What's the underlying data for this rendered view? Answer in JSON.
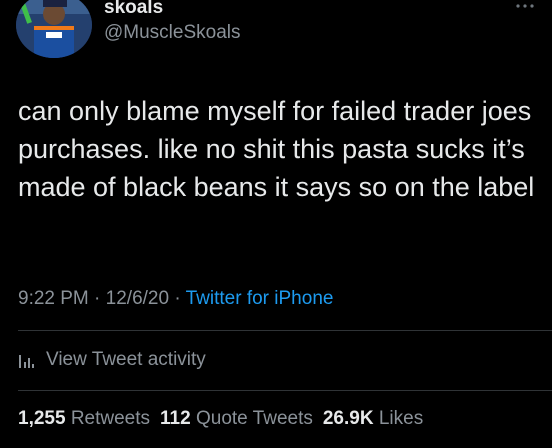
{
  "author": {
    "display_name": "skoals",
    "handle": "@MuscleSkoals",
    "avatar_icon": "avatar-baseball-player"
  },
  "more_icon": "more-dots-icon",
  "tweet": {
    "text": "can only blame myself for failed trader joes purchases. like no shit this pasta sucks it’s made of black beans it says so on the label",
    "time": "9:22 PM",
    "separator": " · ",
    "date": "12/6/20",
    "separator2": " · ",
    "source": "Twitter for iPhone"
  },
  "activity": {
    "icon": "analytics-bars-icon",
    "label": "View Tweet activity"
  },
  "stats": {
    "retweets_count": "1,255",
    "retweets_label": "Retweets",
    "quotes_count": "112",
    "quotes_label": "Quote Tweets",
    "likes_count": "26.9K",
    "likes_label": "Likes"
  },
  "colors": {
    "background": "#000000",
    "text": "#e7e9ea",
    "secondary": "#8b9299",
    "link": "#1d9bf0",
    "divider": "#2f3336"
  }
}
